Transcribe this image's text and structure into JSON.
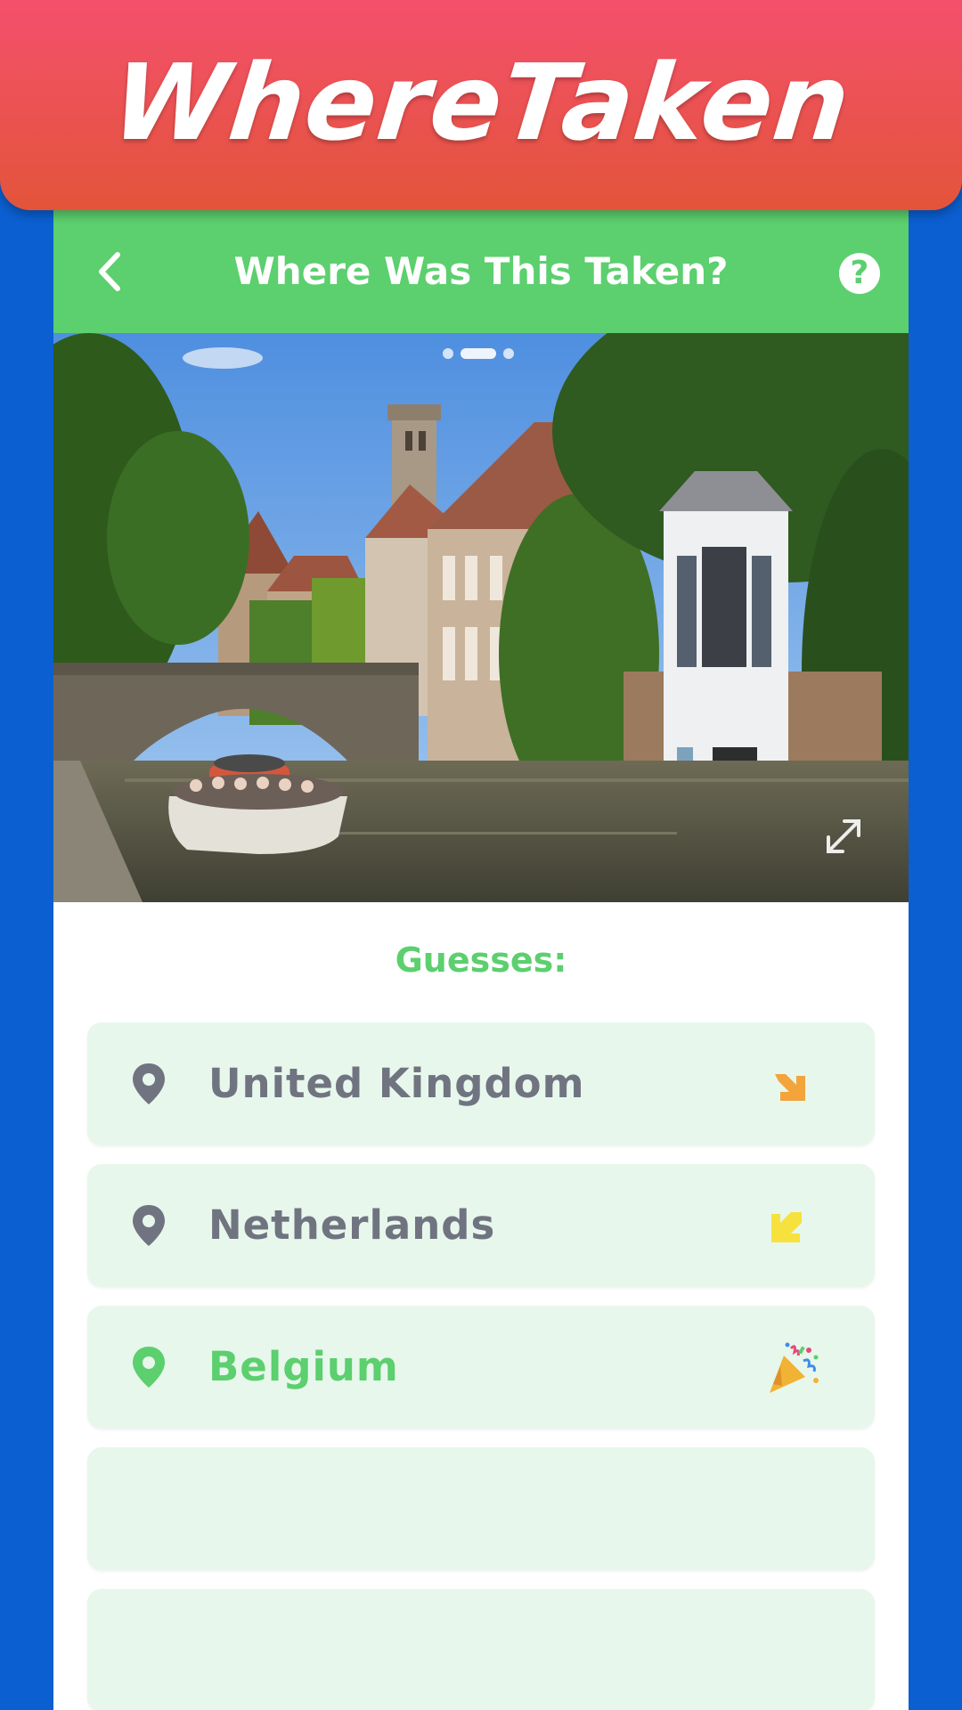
{
  "app": {
    "brand_title": "WhereTaken"
  },
  "header": {
    "title": "Where Was This Taken?",
    "help_label": "?"
  },
  "photo": {
    "carousel_pages": 3,
    "carousel_active_index": 1,
    "description_icon": "expand-icon"
  },
  "guesses": {
    "label": "Guesses:",
    "items": [
      {
        "name": "United Kingdom",
        "icon": "arrow-down-right-icon",
        "color": "#f3a43a",
        "correct": false
      },
      {
        "name": "Netherlands",
        "icon": "arrow-down-left-icon",
        "color": "#f7e23d",
        "correct": false
      },
      {
        "name": "Belgium",
        "icon": "party-popper-icon",
        "correct": true
      },
      {
        "name": "",
        "empty": true
      },
      {
        "name": "",
        "empty": true
      }
    ]
  },
  "colors": {
    "brand_red": "#f4506c",
    "accent_green": "#5ccf6e",
    "background_blue": "#0b5fd1",
    "row_background": "#e7f7ec"
  }
}
